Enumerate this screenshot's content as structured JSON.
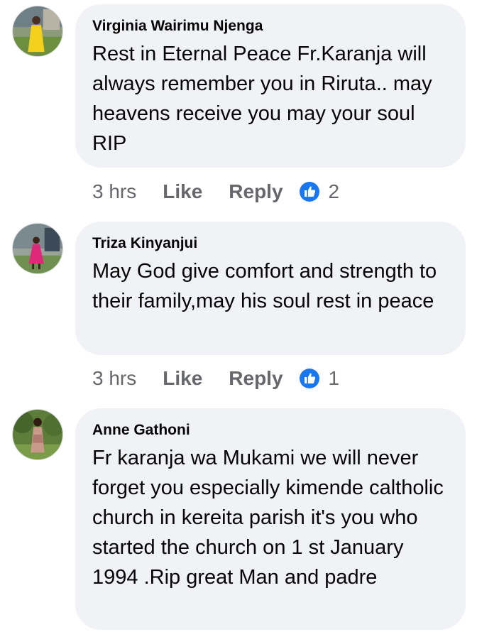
{
  "comments": [
    {
      "author": "Virginia Wairimu Njenga",
      "text": "Rest in Eternal Peace Fr.Karanja will always remember you in Riruta.. may heavens receive you may your soul  RIP",
      "time": "3 hrs",
      "like_label": "Like",
      "reply_label": "Reply",
      "reaction_count": "2",
      "reaction_icon": "thumbs-up-icon"
    },
    {
      "author": "Triza Kinyanjui",
      "text": "May God give comfort and strength to their family,may his soul rest in peace",
      "time": "3 hrs",
      "like_label": "Like",
      "reply_label": "Reply",
      "reaction_count": "1",
      "reaction_icon": "thumbs-up-icon"
    },
    {
      "author": "Anne Gathoni",
      "text": "Fr karanja wa Mukami we will never forget you especially kimende caltholic church in kereita parish it's you who started the church on 1 st January 1994 .Rip great Man and padre"
    }
  ],
  "colors": {
    "bubble": "#f0f2f5",
    "secondary_text": "#65676b",
    "reaction_blue": "#1877f2"
  }
}
